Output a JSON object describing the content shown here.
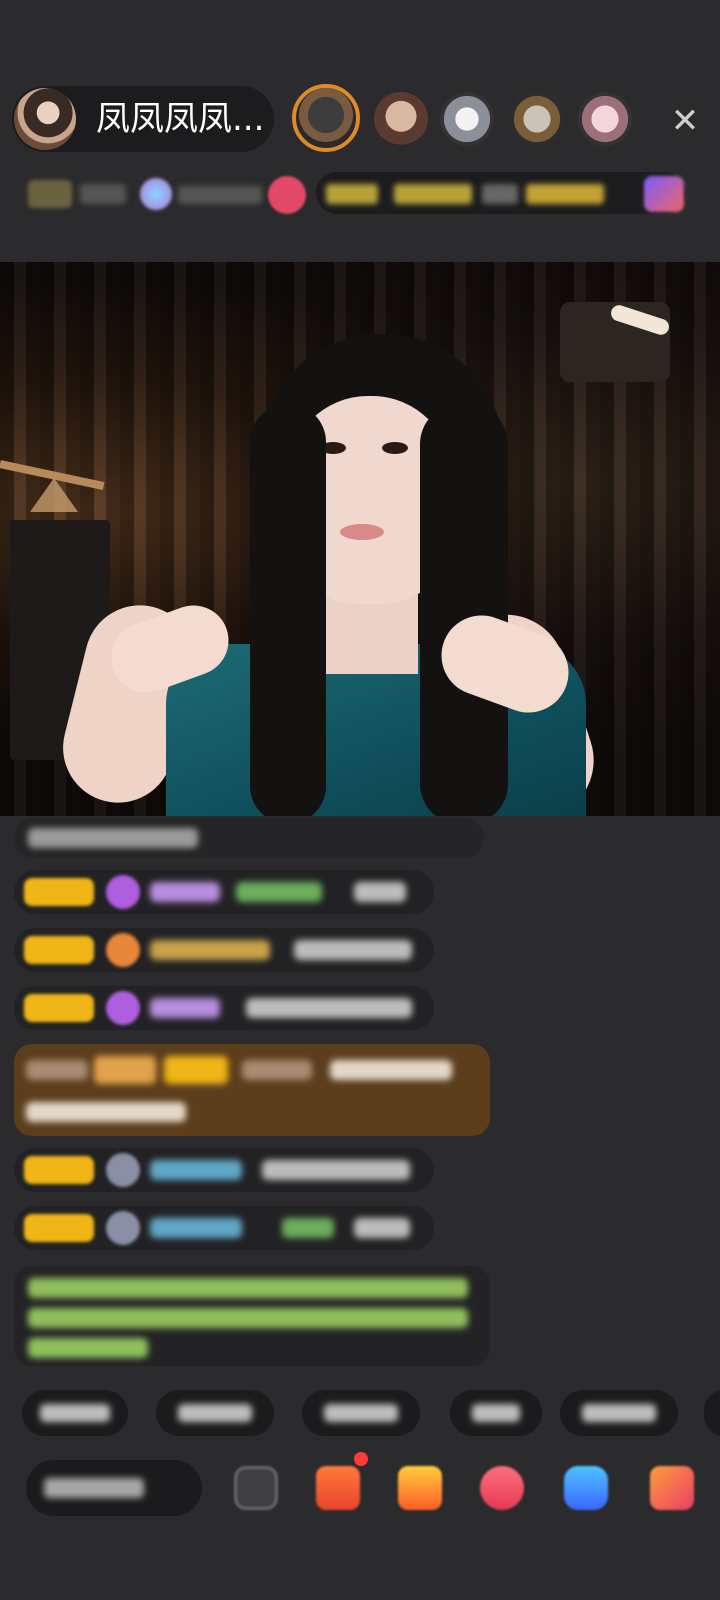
{
  "host": {
    "name": "凤凤凤凤..."
  },
  "top_viewers": [
    {
      "icon": "viewer-avatar-1"
    },
    {
      "icon": "viewer-avatar-2"
    },
    {
      "icon": "viewer-avatar-3"
    },
    {
      "icon": "viewer-avatar-4"
    },
    {
      "icon": "viewer-avatar-5"
    }
  ],
  "close": {
    "icon": "close-icon",
    "glyph": "✕"
  },
  "colors": {
    "background": "#2b2b2d",
    "bubble": "#222224",
    "gold_bubble": "#5c3e1c",
    "level_badge": "#f0b516",
    "accent_red": "#ff3b3b"
  },
  "chat": {
    "messages": [
      {
        "type": "system"
      },
      {
        "type": "user",
        "has_level": true,
        "gem": "purple"
      },
      {
        "type": "user",
        "has_level": true,
        "gem": "orange"
      },
      {
        "type": "user",
        "has_level": true,
        "gem": "purple"
      },
      {
        "type": "highlight-gold"
      },
      {
        "type": "user",
        "has_level": true,
        "gem": "grey"
      },
      {
        "type": "user",
        "has_level": true,
        "gem": "grey"
      },
      {
        "type": "notice-green"
      }
    ]
  },
  "quick_chips": 6,
  "bottom_bar": {
    "icons": [
      "emoji-icon",
      "gift-box-icon",
      "shopping-bag-icon",
      "heart-icon",
      "game-icon",
      "more-icon"
    ]
  }
}
